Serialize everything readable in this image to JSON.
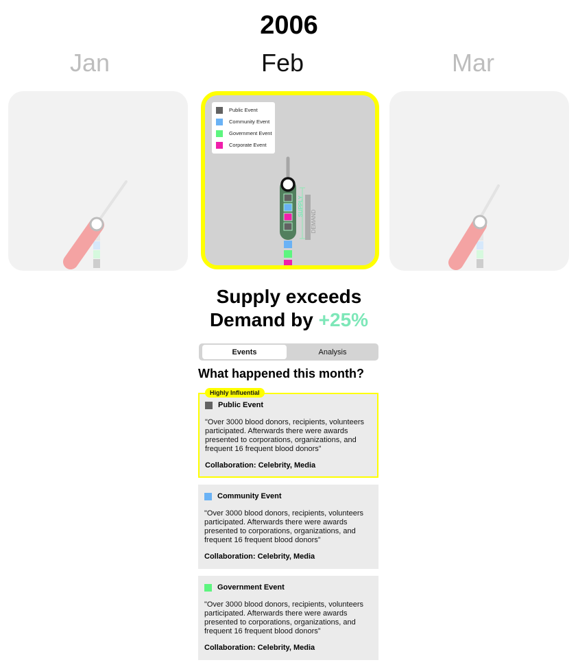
{
  "year": "2006",
  "months": [
    {
      "label": "Jan",
      "state": "inactive"
    },
    {
      "label": "Feb",
      "state": "active"
    },
    {
      "label": "Mar",
      "state": "inactive"
    }
  ],
  "legend": [
    {
      "label": "Public Event",
      "color": "#626262"
    },
    {
      "label": "Community Event",
      "color": "#6ab2f5"
    },
    {
      "label": "Government Event",
      "color": "#5df57f"
    },
    {
      "label": "Corporate Event",
      "color": "#f01eab"
    }
  ],
  "gauge_labels": {
    "supply": "SUPPLY",
    "demand": "DEMAND"
  },
  "headline": {
    "line1": "Supply exceeds",
    "line2_prefix": "Demand by",
    "percent": "+25%"
  },
  "tabs": [
    {
      "label": "Events",
      "active": true
    },
    {
      "label": "Analysis",
      "active": false
    }
  ],
  "section_title": "What happened this month?",
  "events": [
    {
      "badge": "Highly Influential",
      "type": "Public Event",
      "color": "#626262",
      "description": "\"Over 3000 blood donors, recipients, volunteers participated. Afterwards there were awards presented to corporations, organizations, and frequent 16 frequent blood donors”",
      "collaboration": "Collaboration: Celebrity, Media"
    },
    {
      "type": "Community Event",
      "color": "#6ab2f5",
      "description": "\"Over 3000 blood donors, recipients, volunteers participated. Afterwards there were awards presented to corporations, organizations, and frequent 16 frequent blood donors”",
      "collaboration": "Collaboration: Celebrity, Media"
    },
    {
      "type": "Government Event",
      "color": "#5df57f",
      "description": "\"Over 3000 blood donors, recipients, volunteers participated. Afterwards there were awards presented to corporations, organizations, and frequent 16 frequent blood donors”",
      "collaboration": "Collaboration: Celebrity, Media"
    }
  ]
}
